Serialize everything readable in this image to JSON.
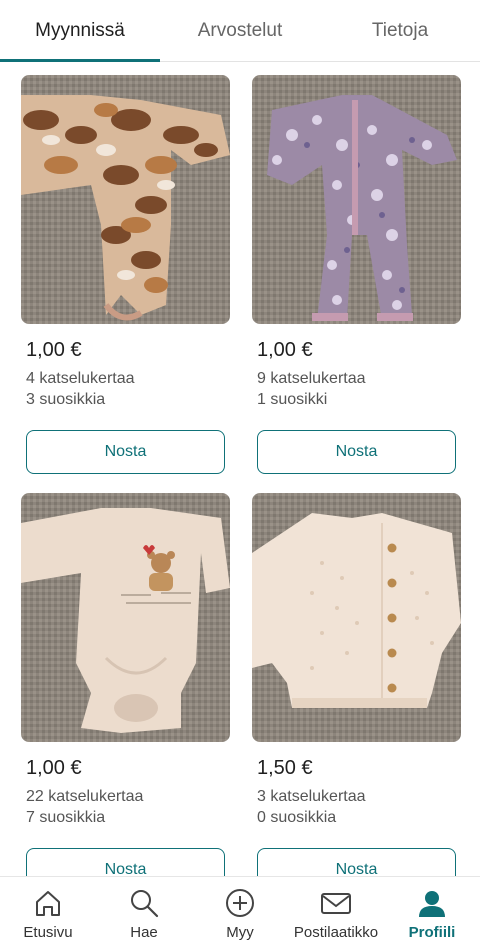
{
  "tabs": [
    {
      "label": "Myynnissä",
      "active": true
    },
    {
      "label": "Arvostelut",
      "active": false
    },
    {
      "label": "Tietoja",
      "active": false
    }
  ],
  "items": [
    {
      "image": "brown-bear-print-bodysuit",
      "price": "1,00 €",
      "views": "4 katselukertaa",
      "likes": "3 suosikkia",
      "button": "Nosta"
    },
    {
      "image": "purple-floral-romper",
      "price": "1,00 €",
      "views": "9 katselukertaa",
      "likes": "1 suosikki",
      "button": "Nosta"
    },
    {
      "image": "cream-teddy-bodysuit",
      "price": "1,00 €",
      "views": "22 katselukertaa",
      "likes": "7 suosikkia",
      "button": "Nosta"
    },
    {
      "image": "cream-knit-cardigan",
      "price": "1,50 €",
      "views": "3 katselukertaa",
      "likes": "0 suosikkia",
      "button": "Nosta"
    }
  ],
  "nav": [
    {
      "label": "Etusivu",
      "icon": "home-icon",
      "active": false
    },
    {
      "label": "Hae",
      "icon": "search-icon",
      "active": false
    },
    {
      "label": "Myy",
      "icon": "plus-circle-icon",
      "active": false
    },
    {
      "label": "Postilaatikko",
      "icon": "mail-icon",
      "active": false
    },
    {
      "label": "Profiili",
      "icon": "profile-icon",
      "active": true
    }
  ],
  "colors": {
    "accent": "#0f7178",
    "text": "#1f1f1f",
    "muted": "#555555"
  }
}
